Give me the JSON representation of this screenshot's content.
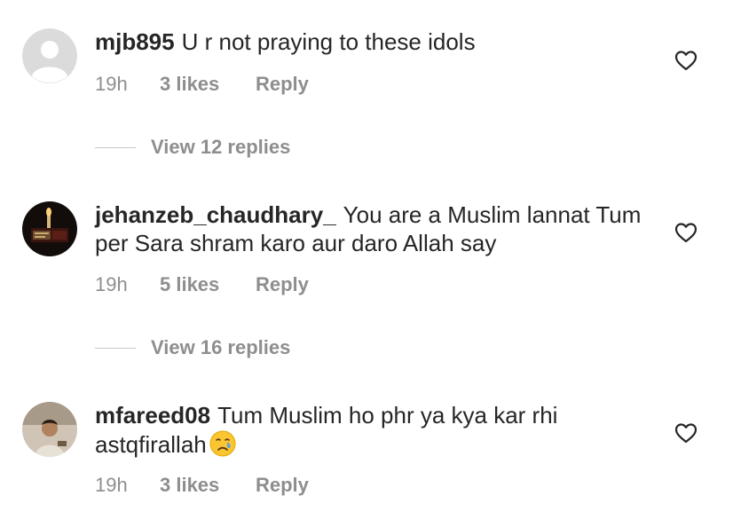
{
  "comments": [
    {
      "username": "mjb895",
      "text": "U r not praying to these idols",
      "time": "19h",
      "likes": "3 likes",
      "reply_label": "Reply",
      "view_replies": "View 12 replies"
    },
    {
      "username": "jehanzeb_chaudhary_",
      "text": "You are a Muslim lannat Tum per Sara shram karo aur daro Allah say",
      "time": "19h",
      "likes": "5 likes",
      "reply_label": "Reply",
      "view_replies": "View 16 replies"
    },
    {
      "username": "mfareed08",
      "text": "Tum Muslim ho phr ya kya kar rhi astqfirallah",
      "emoji": "crying-face",
      "time": "19h",
      "likes": "3 likes",
      "reply_label": "Reply"
    }
  ],
  "colors": {
    "text_primary": "#262626",
    "text_secondary": "#8e8e8e",
    "divider": "#c7c7c7",
    "avatar_placeholder": "#dbdbdb"
  },
  "icons": {
    "like": "heart-outline-icon",
    "default_avatar": "default-avatar-icon"
  }
}
